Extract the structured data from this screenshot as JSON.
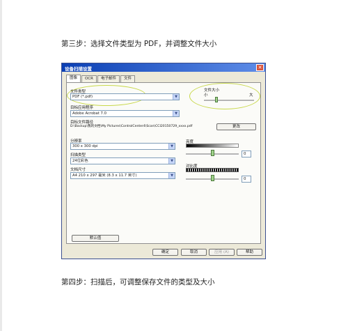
{
  "step3_heading": "第三步：选择文件类型为 PDF，并调整文件大小",
  "step4_heading": "第四步：扫描后，可调整保存文件的类型及大小",
  "dialog": {
    "title": "设备扫描设置",
    "tabs": [
      {
        "label": "图像",
        "active": true
      },
      {
        "label": "OCR",
        "active": false
      },
      {
        "label": "电子邮件",
        "active": false
      },
      {
        "label": "文件",
        "active": false
      }
    ],
    "file_type": {
      "label": "文件类型",
      "value": "PDF (*.pdf)"
    },
    "target_app": {
      "label": "目标应用程序",
      "value": "Adobe Acrobat 7.0"
    },
    "target_path": {
      "label": "目标文件路径",
      "value": "D:\\Backup\\我的文档\\My Pictures\\ControlCenter4\\Scan\\CCI20150729_xxxx.pdf",
      "change_label": "更改"
    },
    "file_size": {
      "label": "文件大小",
      "min_label": "小",
      "max_label": "大",
      "level": 0.25
    },
    "resolution": {
      "label": "分辨率",
      "value": "300 x 300 dpi"
    },
    "scan_type": {
      "label": "扫描类型",
      "value": "24位彩色"
    },
    "document_size": {
      "label": "文档尺寸",
      "value": "A4 210 x 297 毫米 (8.3 x 11.7 英寸)"
    },
    "brightness": {
      "label": "亮度",
      "value": "0",
      "level": 0.5
    },
    "contrast": {
      "label": "对比度",
      "value": "0",
      "level": 0.5
    },
    "buttons": {
      "default": "默认值",
      "ok": "确定",
      "cancel": "取消",
      "apply": "应用 (A)",
      "help": "帮助"
    },
    "colors": {
      "titlebar": "#0a3fb4",
      "highlight_oval": "#c8d84a"
    }
  }
}
